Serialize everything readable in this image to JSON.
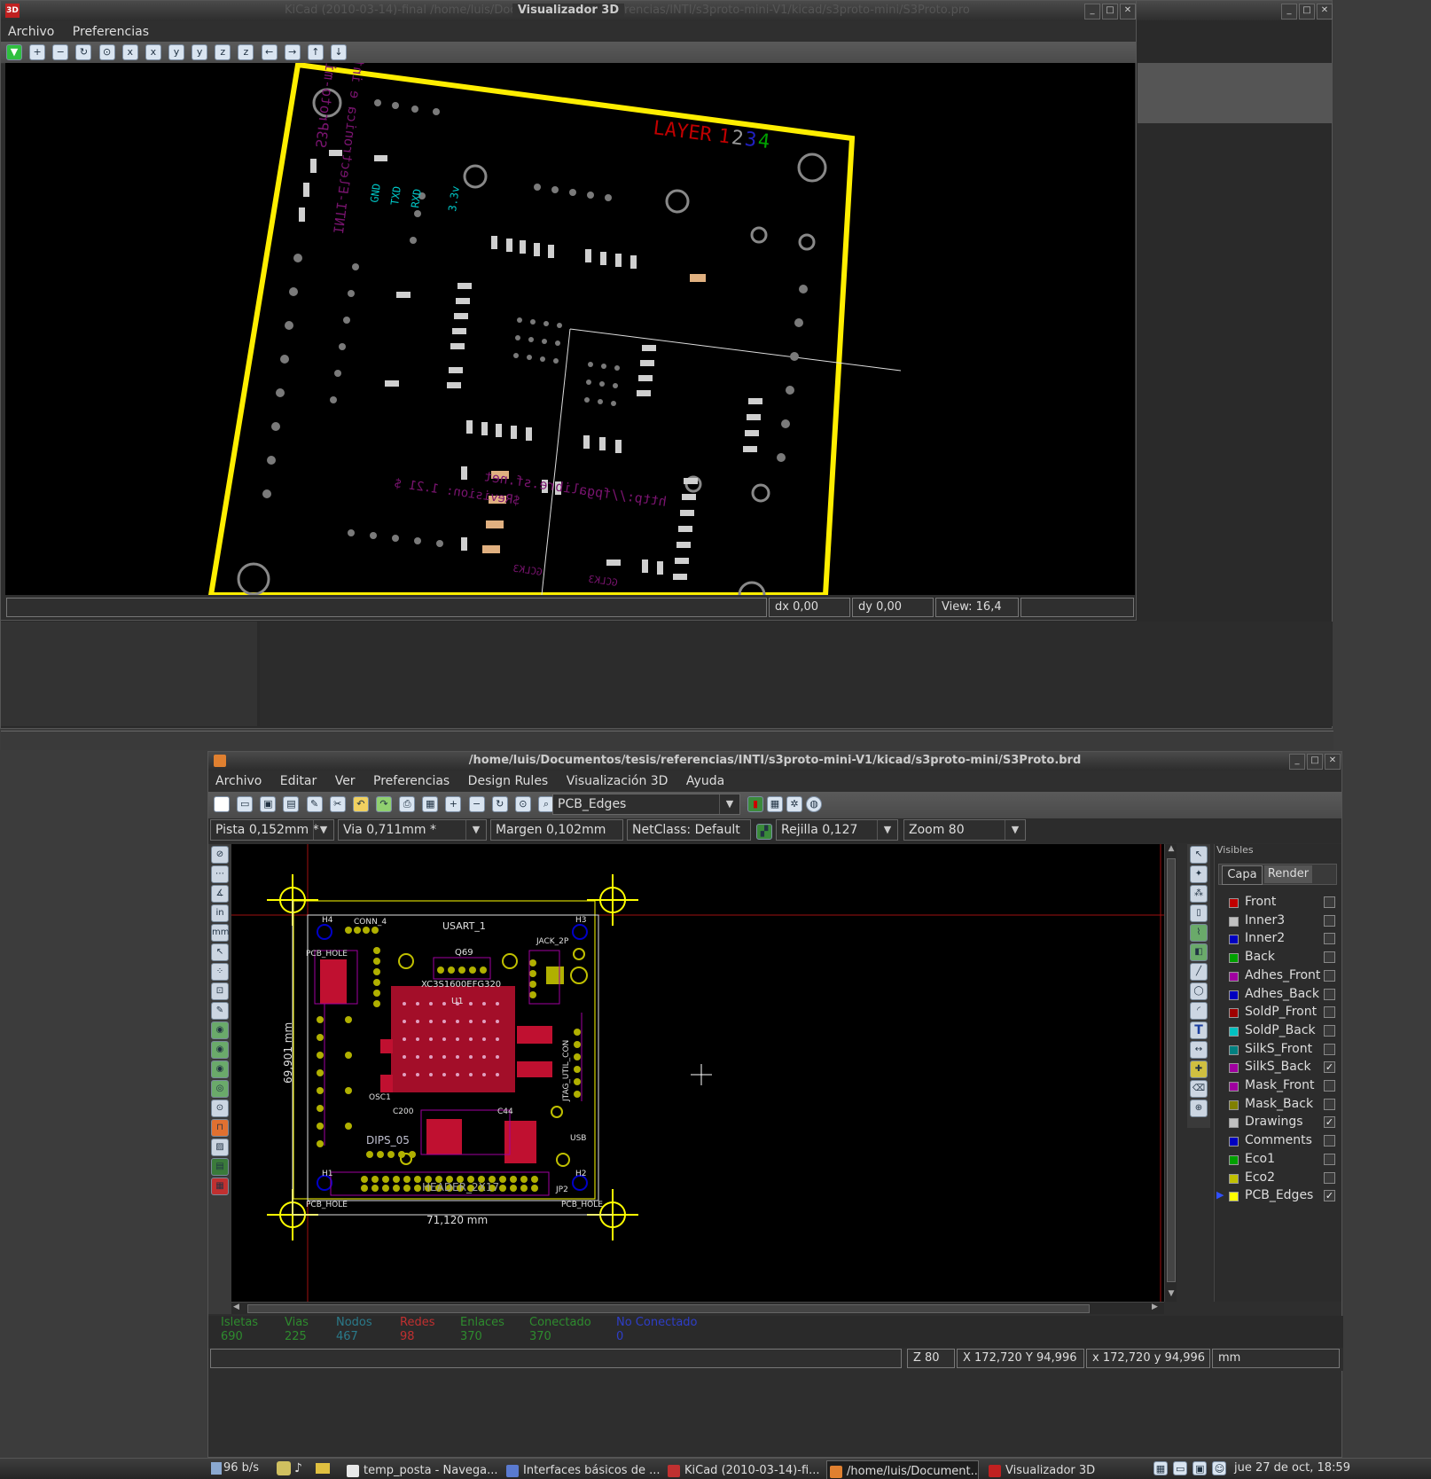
{
  "viewer3d": {
    "app_icon": "3D",
    "ghost_title": "KiCad (2010-03-14)-final /home/luis/Documentos/tesis/referencias/INTI/s3proto-mini-V1/kicad/s3proto-mini/S3Proto.pro",
    "title": "Visualizador 3D",
    "menu": [
      "Archivo",
      "Preferencias"
    ],
    "status": {
      "dx": "dx 0,00",
      "dy": "dy 0,00",
      "view": "View: 16,4"
    },
    "board_text": {
      "layer": "LAYER",
      "layer_nums": [
        "1",
        "2",
        "3",
        "4"
      ],
      "pins": [
        "GND",
        "TXD",
        "RXD",
        "3.3v"
      ],
      "silk": [
        "S3Proto-mini",
        "INTI-Electronica e informatica",
        "http://fpgalibre.sf.net",
        "$Revision: 1.21 $",
        "GCLK3",
        "GCLK3"
      ]
    }
  },
  "pcbnew": {
    "title": "/home/luis/Documentos/tesis/referencias/INTI/s3proto-mini-V1/kicad/s3proto-mini/S3Proto.brd",
    "menu": [
      "Archivo",
      "Editar",
      "Ver",
      "Preferencias",
      "Design Rules",
      "Visualización 3D",
      "Ayuda"
    ],
    "layer_select": "PCB_Edges",
    "track": "Pista 0,152mm *",
    "via": "Via 0,711mm *",
    "margin": "Margen 0,102mm",
    "netclass": "NetClass: Default",
    "grid": "Rejilla 0,127",
    "zoom": "Zoom 80",
    "board_labels": {
      "width_dim": "71,120 mm",
      "height_dim": "69,901 mm",
      "usart": "USART_1",
      "fpga": "XC3S1600EFG320",
      "u1": "U1",
      "osc": "OSC1",
      "dips": "DIPS_05",
      "header": "HEADER_2X17",
      "jtag": "JTAG_UTIL_CON",
      "conn": "CONN_4",
      "jack": "JACK_2P",
      "h1": "H1",
      "h2": "H2",
      "h3": "H3",
      "h4": "H4",
      "pcb_hole": "PCB_HOLE",
      "usb": "USB",
      "jp2": "JP2",
      "c44": "C44",
      "c200": "C200",
      "q69": "Q69"
    },
    "visibles": {
      "title": "Visibles",
      "tabs": [
        "Capa",
        "Render"
      ],
      "layers": [
        {
          "name": "Front",
          "color": "#c00000",
          "checked": false
        },
        {
          "name": "Inner3",
          "color": "#c0c0c0",
          "checked": false
        },
        {
          "name": "Inner2",
          "color": "#0000c0",
          "checked": false
        },
        {
          "name": "Back",
          "color": "#00a000",
          "checked": false
        },
        {
          "name": "Adhes_Front",
          "color": "#a000a0",
          "checked": false
        },
        {
          "name": "Adhes_Back",
          "color": "#0000c0",
          "checked": false
        },
        {
          "name": "SoldP_Front",
          "color": "#a00000",
          "checked": false
        },
        {
          "name": "SoldP_Back",
          "color": "#00c0c0",
          "checked": false
        },
        {
          "name": "SilkS_Front",
          "color": "#008080",
          "checked": false
        },
        {
          "name": "SilkS_Back",
          "color": "#a000a0",
          "checked": true
        },
        {
          "name": "Mask_Front",
          "color": "#a000a0",
          "checked": false
        },
        {
          "name": "Mask_Back",
          "color": "#808000",
          "checked": false
        },
        {
          "name": "Drawings",
          "color": "#c0c0c0",
          "checked": true
        },
        {
          "name": "Comments",
          "color": "#0000c0",
          "checked": false
        },
        {
          "name": "Eco1",
          "color": "#00a000",
          "checked": false
        },
        {
          "name": "Eco2",
          "color": "#c0c000",
          "checked": false
        },
        {
          "name": "PCB_Edges",
          "color": "#ffff00",
          "checked": true
        }
      ]
    },
    "stats": [
      {
        "label": "Isletas",
        "value": "690",
        "color": "#2e8b2e"
      },
      {
        "label": "Vias",
        "value": "225",
        "color": "#2e8b2e"
      },
      {
        "label": "Nodos",
        "value": "467",
        "color": "#2a7a8a"
      },
      {
        "label": "Redes",
        "value": "98",
        "color": "#c03030"
      },
      {
        "label": "Enlaces",
        "value": "370",
        "color": "#2e8b2e"
      },
      {
        "label": "Conectado",
        "value": "370",
        "color": "#2e8b2e"
      },
      {
        "label": "No Conectado",
        "value": "0",
        "color": "#2e3ec8"
      }
    ],
    "statusbar": {
      "z": "Z 80",
      "abs": "X 172,720  Y 94,996",
      "rel": "x 172,720  y 94,996",
      "units": "mm"
    }
  },
  "taskbar": {
    "net": "96 b/s",
    "tasks": [
      {
        "label": "temp_posta - Navega...",
        "icon_color": "#e8e8e8",
        "active": false
      },
      {
        "label": "Interfaces básicos de ...",
        "icon_color": "#5a7ad0",
        "active": false
      },
      {
        "label": "KiCad (2010-03-14)-fi...",
        "icon_color": "#c03030",
        "active": false
      },
      {
        "label": "/home/luis/Document...",
        "icon_color": "#e08030",
        "active": true
      },
      {
        "label": "Visualizador 3D",
        "icon_color": "#c02020",
        "active": false
      }
    ],
    "clock": "jue 27 de oct, 18:59"
  }
}
